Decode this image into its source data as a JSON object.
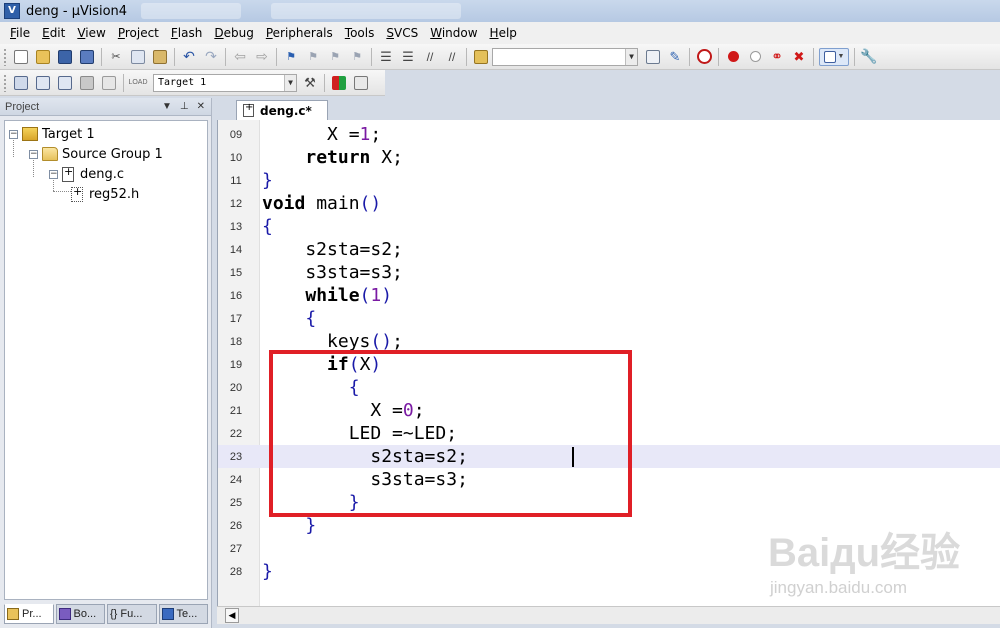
{
  "window": {
    "title": "deng - µVision4"
  },
  "menu": [
    "File",
    "Edit",
    "View",
    "Project",
    "Flash",
    "Debug",
    "Peripherals",
    "Tools",
    "SVCS",
    "Window",
    "Help"
  ],
  "toolbar2": {
    "target_select": "Target 1"
  },
  "project_pane": {
    "header": "Project",
    "tree": {
      "target": "Target 1",
      "group": "Source Group 1",
      "file": "deng.c",
      "include": "reg52.h"
    },
    "bottom_tabs": [
      "Pr...",
      "Bo...",
      "{} Fu...",
      "Te..."
    ]
  },
  "editor": {
    "tab_label": "deng.c*",
    "current_line": "23",
    "lines": [
      {
        "num": "09",
        "text": "      X =1;"
      },
      {
        "num": "10",
        "text": "    return X;"
      },
      {
        "num": "11",
        "text": "}"
      },
      {
        "num": "12",
        "text": "void main()"
      },
      {
        "num": "13",
        "text": "{"
      },
      {
        "num": "14",
        "text": "    s2sta=s2;"
      },
      {
        "num": "15",
        "text": "    s3sta=s3;"
      },
      {
        "num": "16",
        "text": "    while(1)"
      },
      {
        "num": "17",
        "text": "    {"
      },
      {
        "num": "18",
        "text": "      keys();"
      },
      {
        "num": "19",
        "text": "      if(X)"
      },
      {
        "num": "20",
        "text": "        {"
      },
      {
        "num": "21",
        "text": "          X =0;"
      },
      {
        "num": "22",
        "text": "        LED =~LED;"
      },
      {
        "num": "23",
        "text": "          s2sta=s2;"
      },
      {
        "num": "24",
        "text": "          s3sta=s3;"
      },
      {
        "num": "25",
        "text": "        }"
      },
      {
        "num": "26",
        "text": "    }"
      },
      {
        "num": "27",
        "text": ""
      },
      {
        "num": "28",
        "text": "}"
      }
    ]
  },
  "watermark": {
    "main": "Baiдu经验",
    "sub": "jingyan.baidu.com"
  },
  "colors": {
    "highlight_box": "#e01f26",
    "current_line_bg": "#e8e8f8",
    "number_literal": "#7a1aa3",
    "punctuation": "#1a1aa8"
  }
}
